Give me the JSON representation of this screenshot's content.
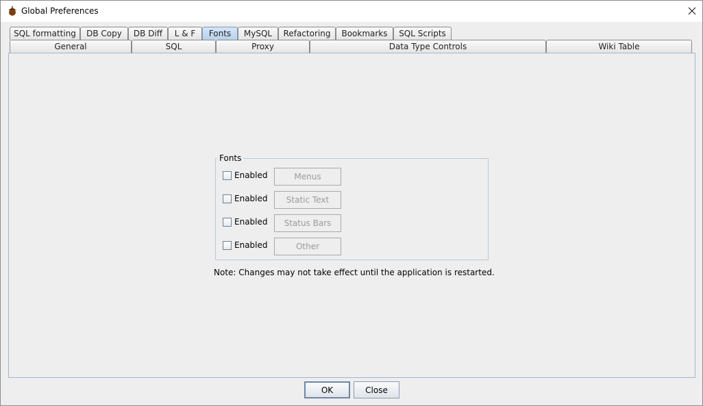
{
  "window": {
    "title": "Global Preferences"
  },
  "tabs_row1": [
    "SQL formatting",
    "DB Copy",
    "DB Diff",
    "L & F",
    "Fonts",
    "MySQL",
    "Refactoring",
    "Bookmarks",
    "SQL Scripts"
  ],
  "tabs_row2": [
    "General",
    "SQL",
    "Proxy",
    "Data Type Controls",
    "Wiki Table"
  ],
  "selected_tab": "Fonts",
  "fonts_group": {
    "legend": "Fonts",
    "rows": [
      {
        "checkbox_label": "Enabled",
        "button_label": "Menus",
        "checked": false
      },
      {
        "checkbox_label": "Enabled",
        "button_label": "Static Text",
        "checked": false
      },
      {
        "checkbox_label": "Enabled",
        "button_label": "Status Bars",
        "checked": false
      },
      {
        "checkbox_label": "Enabled",
        "button_label": "Other",
        "checked": false
      }
    ]
  },
  "note": "Note: Changes may not take effect until the application is restarted.",
  "buttons": {
    "ok": "OK",
    "close": "Close"
  }
}
